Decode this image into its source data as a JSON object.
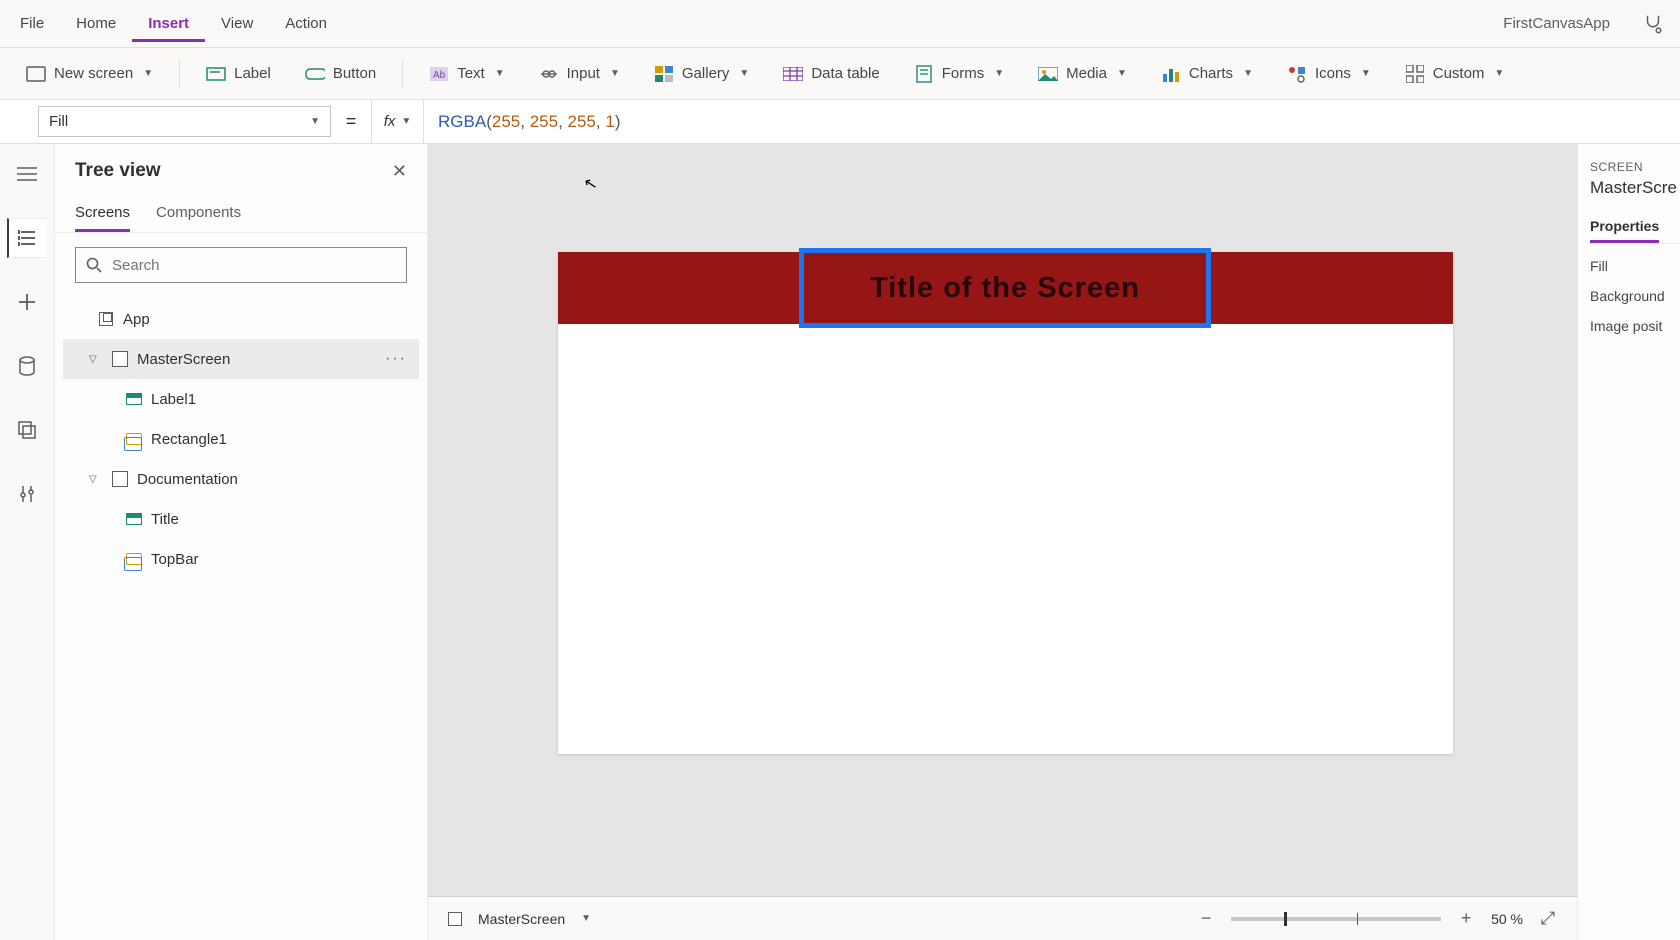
{
  "menubar": {
    "items": [
      "File",
      "Home",
      "Insert",
      "View",
      "Action"
    ],
    "active_index": 2,
    "app_name": "FirstCanvasApp"
  },
  "ribbon": {
    "new_screen": "New screen",
    "label": "Label",
    "button": "Button",
    "text": "Text",
    "input": "Input",
    "gallery": "Gallery",
    "data_table": "Data table",
    "forms": "Forms",
    "media": "Media",
    "charts": "Charts",
    "icons": "Icons",
    "custom": "Custom"
  },
  "formula": {
    "property": "Fill",
    "fn": "RGBA",
    "args": [
      "255",
      "255",
      "255",
      "1"
    ]
  },
  "tree": {
    "title": "Tree view",
    "tabs": [
      "Screens",
      "Components"
    ],
    "active_tab": 0,
    "search_placeholder": "Search",
    "nodes": {
      "app": "App",
      "master": "MasterScreen",
      "label1": "Label1",
      "rectangle1": "Rectangle1",
      "documentation": "Documentation",
      "title": "Title",
      "topbar": "TopBar"
    }
  },
  "canvas": {
    "title_text": "Title of the Screen",
    "topbar_color": "#961515",
    "selection_border": "#1f74f0"
  },
  "status": {
    "screen_name": "MasterScreen",
    "zoom": "50  %"
  },
  "props": {
    "context_type": "SCREEN",
    "context_name": "MasterScre",
    "tabs": [
      "Properties"
    ],
    "rows": [
      "Fill",
      "Background",
      "Image posit"
    ]
  }
}
